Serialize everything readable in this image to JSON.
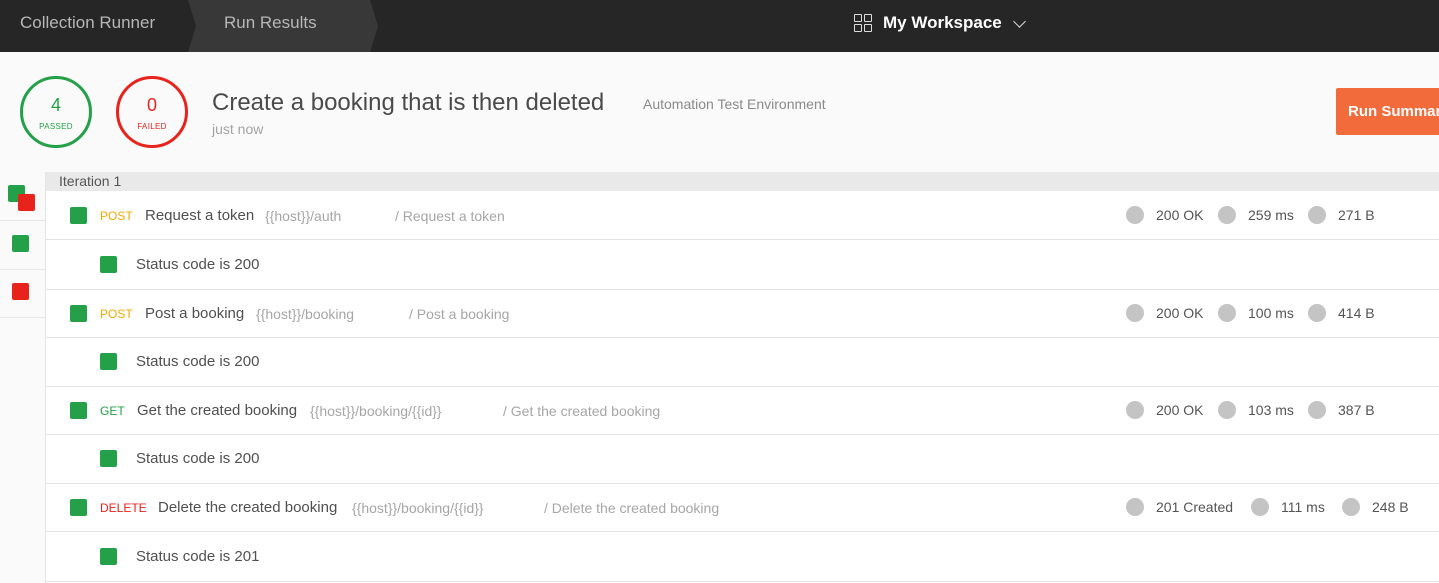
{
  "topbar": {
    "crumb_runner": "Collection Runner",
    "crumb_results": "Run Results",
    "workspace": "My Workspace"
  },
  "header": {
    "passed_count": "4",
    "passed_label": "PASSED",
    "failed_count": "0",
    "failed_label": "FAILED",
    "title": "Create a booking that is then deleted",
    "environment": "Automation Test Environment",
    "time": "just now",
    "summary_button": "Run Summary"
  },
  "iteration": {
    "label": "Iteration 1"
  },
  "requests": [
    {
      "method": "POST",
      "name": "Request a token",
      "url": "{{host}}/auth",
      "path": "/ Request a token",
      "status": "200 OK",
      "time": "259 ms",
      "size": "271 B",
      "test": "Status code is 200"
    },
    {
      "method": "POST",
      "name": "Post a booking",
      "url": "{{host}}/booking",
      "path": "/ Post a booking",
      "status": "200 OK",
      "time": "100 ms",
      "size": "414 B",
      "test": "Status code is 200"
    },
    {
      "method": "GET",
      "name": "Get the created booking",
      "url": "{{host}}/booking/{{id}}",
      "path": "/ Get the created booking",
      "status": "200 OK",
      "time": "103 ms",
      "size": "387 B",
      "test": "Status code is 200"
    },
    {
      "method": "DELETE",
      "name": "Delete the created booking",
      "url": "{{host}}/booking/{{id}}",
      "path": "/ Delete the created booking",
      "status": "201 Created",
      "time": "111 ms",
      "size": "248 B",
      "test": "Status code is 201"
    }
  ],
  "colors": {
    "pass": "#24a148",
    "fail": "#e8231c",
    "post": "#f2a900",
    "accent": "#f26b3a"
  }
}
